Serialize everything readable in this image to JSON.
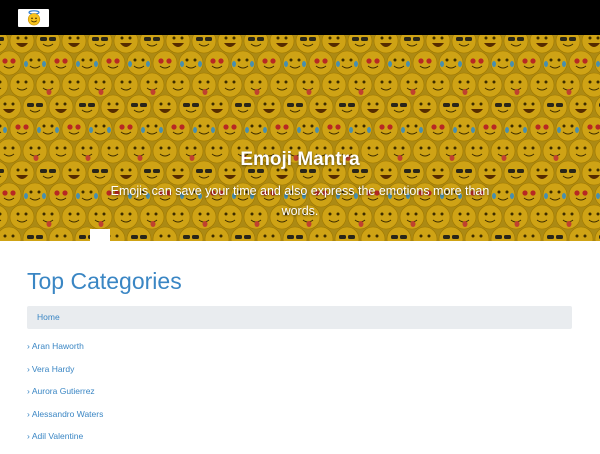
{
  "header": {
    "logo_icon": "halo-smiley-icon",
    "background": "#000000"
  },
  "hero": {
    "title": "Emoji Mantra",
    "tagline": "Emojis can save your time and also express the emotions more than words.",
    "background_pattern": "emoji-faces"
  },
  "categories": {
    "heading": "Top Categories",
    "breadcrumb": {
      "home_label": "Home"
    },
    "chevron": "›",
    "items": [
      {
        "label": "Aran Haworth"
      },
      {
        "label": "Vera Hardy"
      },
      {
        "label": "Aurora Gutierrez"
      },
      {
        "label": "Alessandro Waters"
      },
      {
        "label": "Adil Valentine"
      }
    ]
  },
  "colors": {
    "link": "#3a86c4",
    "breadcrumb_bg": "#e9ecef",
    "emoji_yellow": "#f7c21c"
  }
}
